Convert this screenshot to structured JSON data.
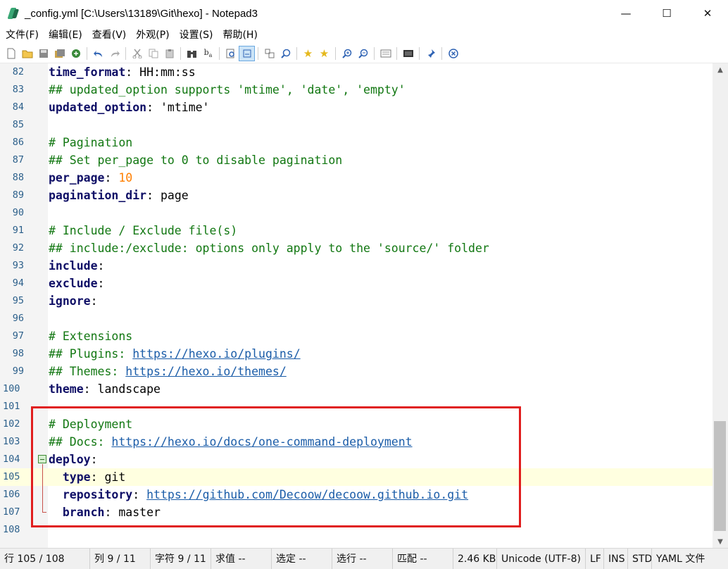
{
  "window": {
    "title": "_config.yml [C:\\Users\\13189\\Git\\hexo] - Notepad3",
    "minimize": "—",
    "maximize": "☐",
    "close": "✕"
  },
  "menu": [
    "文件(F)",
    "编辑(E)",
    "查看(V)",
    "外观(P)",
    "设置(S)",
    "帮助(H)"
  ],
  "toolbar_icons": [
    "new-file-icon",
    "open-folder-icon",
    "save-icon",
    "save-as-icon",
    "browse-icon",
    "undo-icon",
    "redo-icon",
    "cut-icon",
    "copy-icon",
    "paste-icon",
    "find-icon",
    "replace-icon",
    "goto-icon",
    "word-wrap-icon",
    "toggle-fold-icon",
    "zoom-find-icon",
    "favorites-icon",
    "add-favorite-icon",
    "zoom-in-icon",
    "zoom-out-icon",
    "scheme-icon",
    "customize-scheme-icon",
    "pin-icon",
    "exit-icon"
  ],
  "editor": {
    "lines": [
      {
        "n": "82"
      },
      {
        "n": "83"
      },
      {
        "n": "84"
      },
      {
        "n": "85"
      },
      {
        "n": "86"
      },
      {
        "n": "87"
      },
      {
        "n": "88"
      },
      {
        "n": "89"
      },
      {
        "n": "90"
      },
      {
        "n": "91"
      },
      {
        "n": "92"
      },
      {
        "n": "93"
      },
      {
        "n": "94"
      },
      {
        "n": "95"
      },
      {
        "n": "96"
      },
      {
        "n": "97"
      },
      {
        "n": "98"
      },
      {
        "n": "99"
      },
      {
        "n": "100"
      },
      {
        "n": "101"
      },
      {
        "n": "102"
      },
      {
        "n": "103"
      },
      {
        "n": "104"
      },
      {
        "n": "105"
      },
      {
        "n": "106"
      },
      {
        "n": "107"
      },
      {
        "n": "108"
      }
    ],
    "code": {
      "l82_key": "time_format",
      "l82_val": "HH:mm:ss",
      "l83": "## updated_option supports 'mtime', 'date', 'empty'",
      "l84_key": "updated_option",
      "l84_val": "'mtime'",
      "l86": "# Pagination",
      "l87": "## Set per_page to 0 to disable pagination",
      "l88_key": "per_page",
      "l88_val": "10",
      "l89_key": "pagination_dir",
      "l89_val": "page",
      "l91": "# Include / Exclude file(s)",
      "l92": "## include:/exclude: options only apply to the 'source/' folder",
      "l93_key": "include",
      "l94_key": "exclude",
      "l95_key": "ignore",
      "l97": "# Extensions",
      "l98_cmt": "## Plugins:",
      "l98_url": "https://hexo.io/plugins/",
      "l99_cmt": "## Themes:",
      "l99_url": "https://hexo.io/themes/",
      "l100_key": "theme",
      "l100_val": "landscape",
      "l102": "# Deployment",
      "l103_cmt": "## Docs:",
      "l103_url": "https://hexo.io/docs/one-command-deployment",
      "l104_key": "deploy",
      "l105_key": "type",
      "l105_val": "git",
      "l106_key": "repository",
      "l106_url": "https://github.com/Decoow/decoow.github.io.git",
      "l107_key": "branch",
      "l107_val": "master"
    },
    "current_line": 105
  },
  "status": {
    "line": "行 105 / 108",
    "col": "列  9 / 11",
    "char": "字符  9 / 11",
    "eval": "求值  --",
    "sel": "选定  --",
    "sel_lines": "选行  --",
    "match": "匹配  --",
    "size": "2.46 KB",
    "encoding": "Unicode (UTF-8)",
    "eol": "LF",
    "ins": "INS",
    "std": "STD",
    "lexer": "YAML 文件"
  }
}
